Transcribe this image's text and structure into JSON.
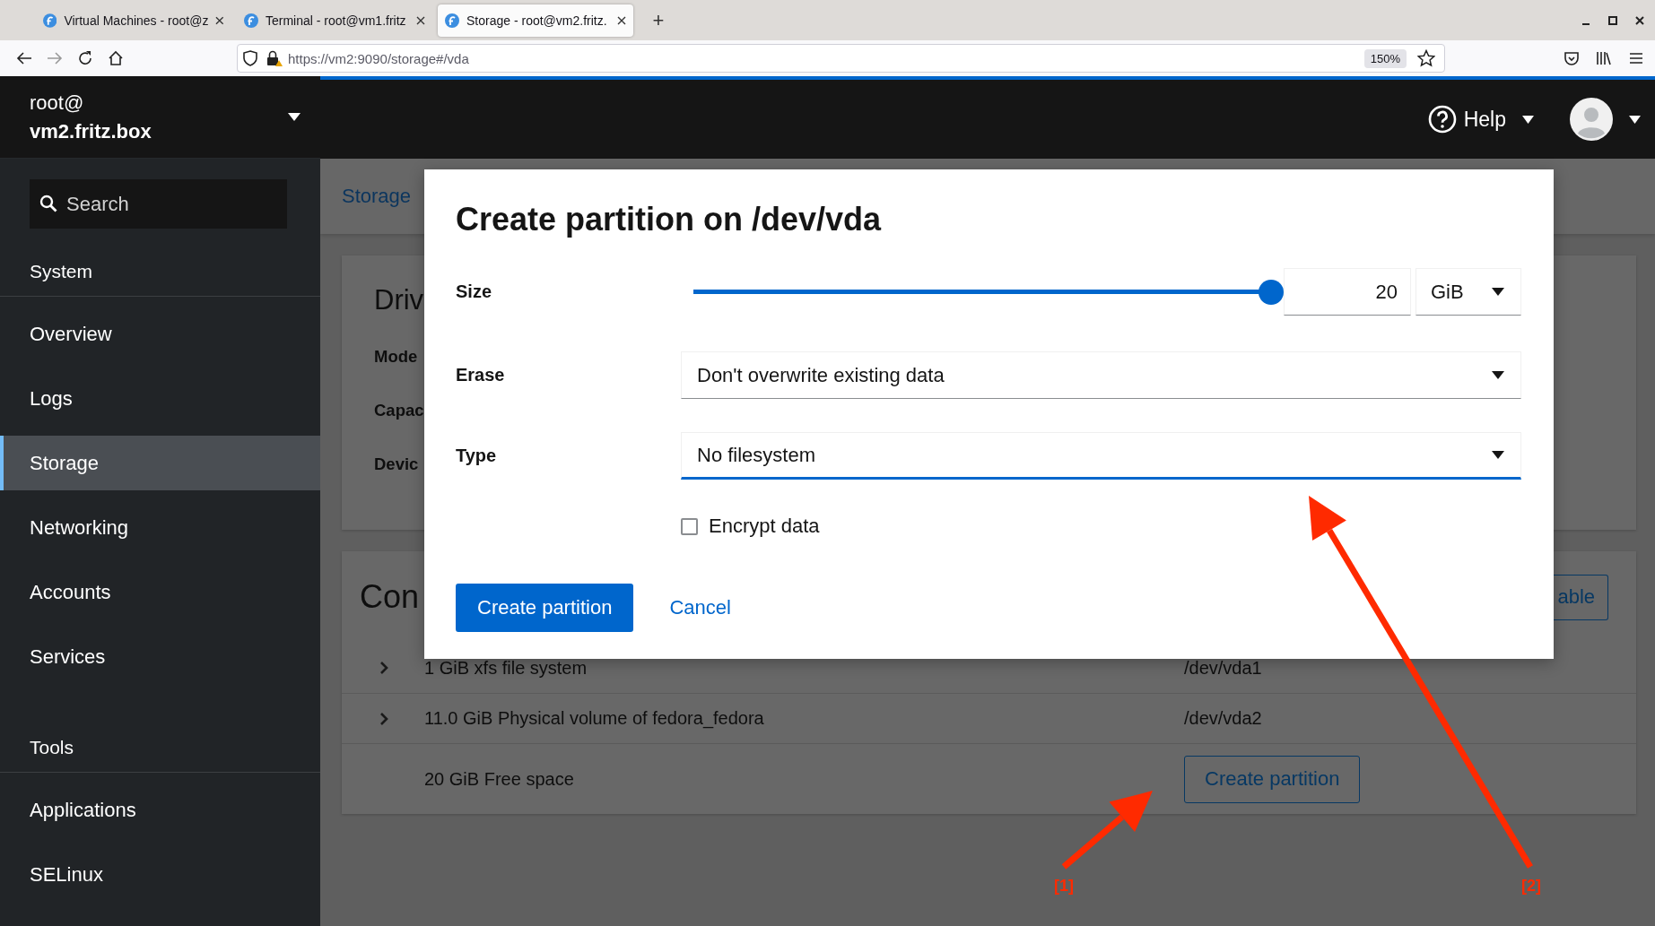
{
  "browser": {
    "tabs": [
      {
        "title": "Virtual Machines - root@z",
        "selected": false
      },
      {
        "title": "Terminal - root@vm1.fritz",
        "selected": false
      },
      {
        "title": "Storage - root@vm2.fritz.",
        "selected": true
      }
    ],
    "new_tab": "+",
    "url": "https://vm2:9090/storage#/vda",
    "zoom": "150%"
  },
  "host": {
    "user": "root@",
    "name": "vm2.fritz.box"
  },
  "sidebar": {
    "search": {
      "placeholder": "Search"
    },
    "groups": [
      {
        "title": "System",
        "items": [
          {
            "label": "Overview",
            "selected": false
          },
          {
            "label": "Logs",
            "selected": false
          },
          {
            "label": "Storage",
            "selected": true
          },
          {
            "label": "Networking",
            "selected": false
          },
          {
            "label": "Accounts",
            "selected": false
          },
          {
            "label": "Services",
            "selected": false
          }
        ]
      },
      {
        "title": "Tools",
        "items": [
          {
            "label": "Applications",
            "selected": false
          },
          {
            "label": "SELinux",
            "selected": false
          }
        ]
      }
    ]
  },
  "topbar": {
    "help": "Help"
  },
  "breadcrumb": "Storage",
  "drive_card": {
    "title": "Driv",
    "fields": [
      "Mode",
      "Capac",
      "Devic"
    ]
  },
  "content_card": {
    "title": "Con",
    "action": "able",
    "rows": [
      {
        "name": "1 GiB xfs file system",
        "device": "/dev/vda1",
        "expandable": true
      },
      {
        "name": "11.0 GiB Physical volume of fedora_fedora",
        "device": "/dev/vda2",
        "expandable": true
      },
      {
        "name": "20 GiB Free space",
        "action": "Create partition",
        "expandable": false
      }
    ]
  },
  "dialog": {
    "title": "Create partition on /dev/vda",
    "fields": [
      {
        "kind": "slider",
        "label": "Size",
        "level": 1.0,
        "value": "20",
        "unit": "GiB"
      },
      {
        "kind": "select",
        "label": "Erase",
        "value": "Don't overwrite existing data",
        "focused": false
      },
      {
        "kind": "select",
        "label": "Type",
        "value": "No filesystem",
        "focused": true
      },
      {
        "kind": "checkbox",
        "label": "Encrypt data",
        "checked": false
      }
    ],
    "buttons": [
      {
        "label": "Create partition",
        "kind": "primary"
      },
      {
        "label": "Cancel",
        "kind": "link"
      }
    ]
  },
  "annotations": [
    {
      "label": "[1]"
    },
    {
      "label": "[2]"
    }
  ]
}
